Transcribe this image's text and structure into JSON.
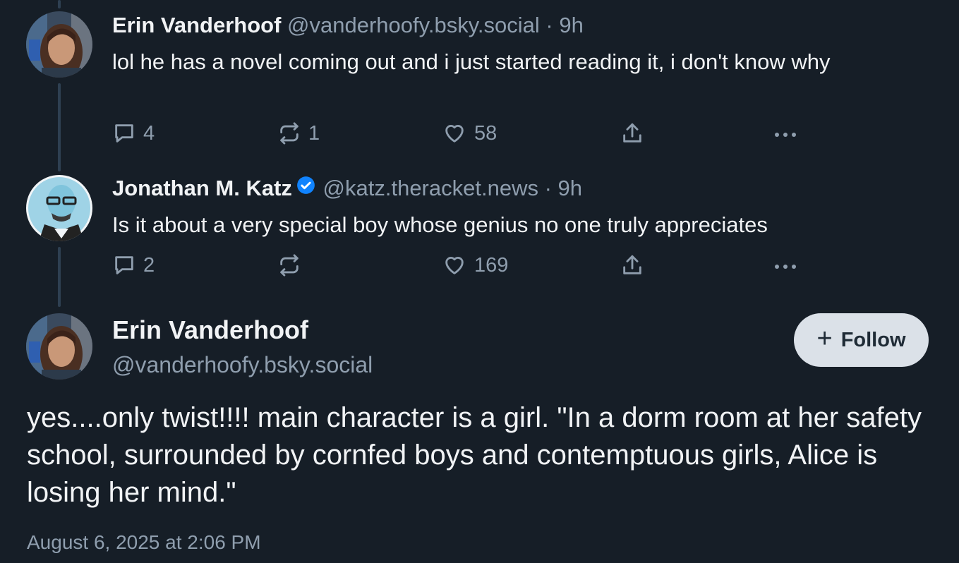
{
  "posts": [
    {
      "author_name": "Erin Vanderhoof",
      "handle": "@vanderhoofy.bsky.social",
      "time": "· 9h",
      "text": "lol he has a novel coming out and i just started reading it, i don't know why",
      "replies": "4",
      "reposts": "1",
      "likes": "58"
    },
    {
      "author_name": "Jonathan M. Katz",
      "verified": true,
      "handle": "@katz.theracket.news",
      "time": "· 9h",
      "text": "Is it about a very special boy whose genius no one truly appreciates",
      "replies": "2",
      "reposts": "",
      "likes": "169"
    }
  ],
  "focused_post": {
    "author_name": "Erin Vanderhoof",
    "handle": "@vanderhoofy.bsky.social",
    "follow_label": "Follow",
    "text": "yes....only twist!!!! main character is a girl. \"In a dorm room at her safety school, surrounded by cornfed boys and contemptuous girls, Alice is losing her mind.\"",
    "timestamp": "August 6, 2025 at 2:06 PM"
  },
  "icons": {
    "reply": "reply-icon",
    "repost": "repost-icon",
    "like": "heart-icon",
    "share": "share-icon",
    "more": "more-icon",
    "verified": "verified-check-icon"
  },
  "colors": {
    "background": "#161e27",
    "muted_text": "#8f9eae",
    "verified_blue": "#1083fe",
    "follow_button": "#dbe1e8"
  }
}
